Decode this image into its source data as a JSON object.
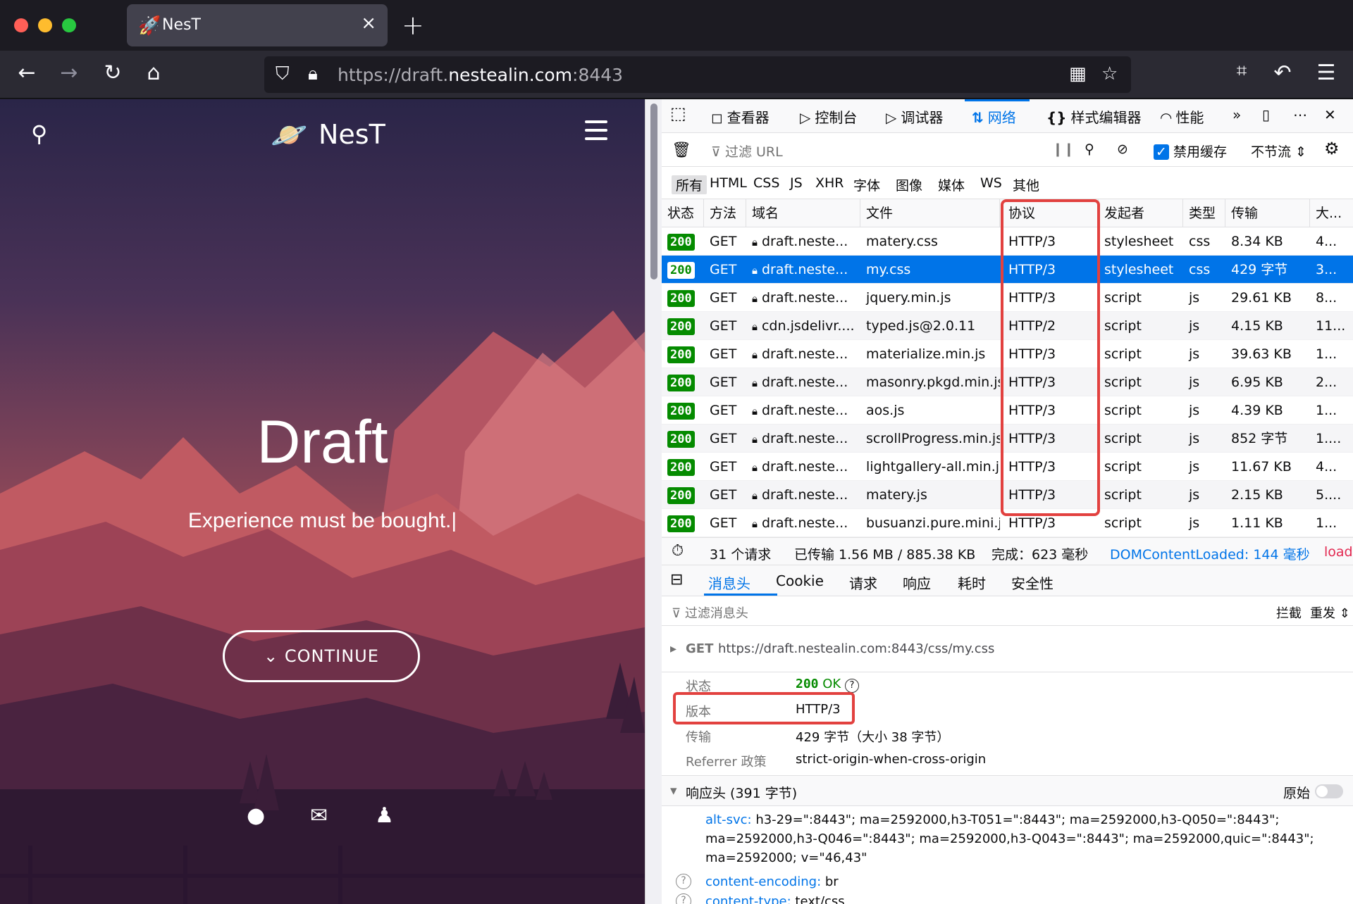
{
  "tab": {
    "title": "NesT",
    "close": "×"
  },
  "url": {
    "prefix": "https://draft.",
    "domain": "nestealin.com",
    "port": ":8443"
  },
  "site": {
    "brand": "NesT",
    "hero_title": "Draft",
    "hero_subtitle": "Experience must be bought.|",
    "continue_label": "CONTINUE"
  },
  "devtools": {
    "tabs": [
      "查看器",
      "控制台",
      "调试器",
      "网络",
      "样式编辑器",
      "性能"
    ],
    "filter_placeholder": "过滤 URL",
    "disable_cache": "禁用缓存",
    "throttle": "不节流 ⇕",
    "type_filters": [
      "所有",
      "HTML",
      "CSS",
      "JS",
      "XHR",
      "字体",
      "图像",
      "媒体",
      "WS",
      "其他"
    ],
    "columns": [
      "状态",
      "方法",
      "域名",
      "文件",
      "协议",
      "发起者",
      "类型",
      "传输",
      "大..."
    ],
    "rows": [
      {
        "status": "200",
        "method": "GET",
        "domain": "draft.neste...",
        "file": "matery.css",
        "protocol": "HTTP/3",
        "initiator": "stylesheet",
        "type": "css",
        "transfer": "8.34 KB",
        "size": "4..."
      },
      {
        "status": "200",
        "method": "GET",
        "domain": "draft.neste...",
        "file": "my.css",
        "protocol": "HTTP/3",
        "initiator": "stylesheet",
        "type": "css",
        "transfer": "429 字节",
        "size": "3..."
      },
      {
        "status": "200",
        "method": "GET",
        "domain": "draft.neste...",
        "file": "jquery.min.js",
        "protocol": "HTTP/3",
        "initiator": "script",
        "type": "js",
        "transfer": "29.61 KB",
        "size": "8..."
      },
      {
        "status": "200",
        "method": "GET",
        "domain": "cdn.jsdelivr....",
        "file": "typed.js@2.0.11",
        "protocol": "HTTP/2",
        "initiator": "script",
        "type": "js",
        "transfer": "4.15 KB",
        "size": "11..."
      },
      {
        "status": "200",
        "method": "GET",
        "domain": "draft.neste...",
        "file": "materialize.min.js",
        "protocol": "HTTP/3",
        "initiator": "script",
        "type": "js",
        "transfer": "39.63 KB",
        "size": "1..."
      },
      {
        "status": "200",
        "method": "GET",
        "domain": "draft.neste...",
        "file": "masonry.pkgd.min.js",
        "protocol": "HTTP/3",
        "initiator": "script",
        "type": "js",
        "transfer": "6.95 KB",
        "size": "2..."
      },
      {
        "status": "200",
        "method": "GET",
        "domain": "draft.neste...",
        "file": "aos.js",
        "protocol": "HTTP/3",
        "initiator": "script",
        "type": "js",
        "transfer": "4.39 KB",
        "size": "1..."
      },
      {
        "status": "200",
        "method": "GET",
        "domain": "draft.neste...",
        "file": "scrollProgress.min.js",
        "protocol": "HTTP/3",
        "initiator": "script",
        "type": "js",
        "transfer": "852 字节",
        "size": "1...."
      },
      {
        "status": "200",
        "method": "GET",
        "domain": "draft.neste...",
        "file": "lightgallery-all.min.js",
        "protocol": "HTTP/3",
        "initiator": "script",
        "type": "js",
        "transfer": "11.67 KB",
        "size": "4..."
      },
      {
        "status": "200",
        "method": "GET",
        "domain": "draft.neste...",
        "file": "matery.js",
        "protocol": "HTTP/3",
        "initiator": "script",
        "type": "js",
        "transfer": "2.15 KB",
        "size": "5...."
      },
      {
        "status": "200",
        "method": "GET",
        "domain": "draft.neste...",
        "file": "busuanzi.pure.mini.js",
        "protocol": "HTTP/3",
        "initiator": "script",
        "type": "js",
        "transfer": "1.11 KB",
        "size": "1..."
      }
    ],
    "summary": {
      "requests": "31 个请求",
      "transferred": "已传输 1.56 MB / 885.38 KB",
      "finish": "完成：623 毫秒",
      "dcl": "DOMContentLoaded: 144 毫秒",
      "load": "load:"
    },
    "detail_tabs": [
      "消息头",
      "Cookie",
      "请求",
      "响应",
      "耗时",
      "安全性"
    ],
    "header_filter": "过滤消息头",
    "block": "拦截",
    "resend": "重发 ⇕",
    "request_method": "GET",
    "request_url": "https://draft.nestealin.com:8443/css/my.css",
    "status_label": "状态",
    "status_code": "200",
    "status_text": "OK",
    "version_label": "版本",
    "version_value": "HTTP/3",
    "transfer_label": "传输",
    "transfer_value": "429 字节（大小 38 字节）",
    "referrer_label": "Referrer 政策",
    "referrer_value": "strict-origin-when-cross-origin",
    "response_headers": "响应头 (391 字节)",
    "raw": "原始",
    "alt_svc_name": "alt-svc:",
    "alt_svc_value": "h3-29=\":8443\"; ma=2592000,h3-T051=\":8443\"; ma=2592000,h3-Q050=\":8443\"; ma=2592000,h3-Q046=\":8443\"; ma=2592000,h3-Q043=\":8443\"; ma=2592000,quic=\":8443\"; ma=2592000; v=\"46,43\"",
    "ce_name": "content-encoding:",
    "ce_value": "br",
    "ct_name": "content-type:",
    "ct_value": "text/css"
  },
  "colors": {
    "accent": "#0074e8",
    "status_ok": "#058b00",
    "highlight": "#e2413f"
  }
}
